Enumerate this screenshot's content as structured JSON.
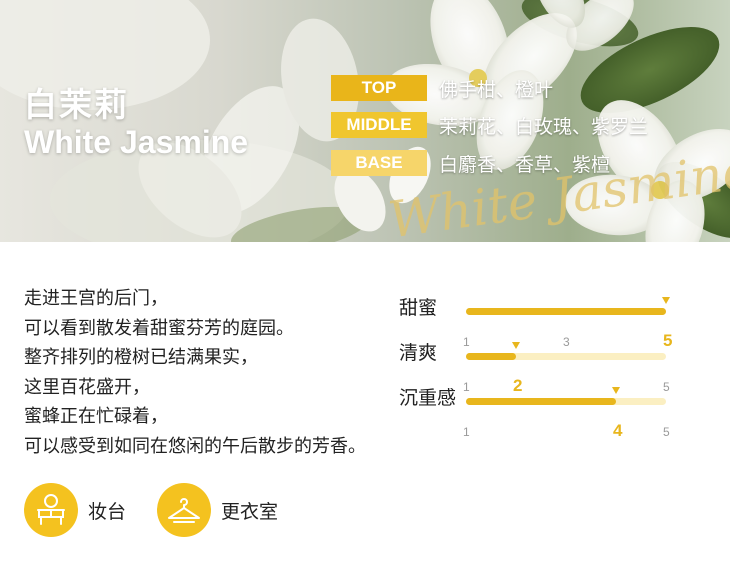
{
  "banner": {
    "title_cn": "白茉莉",
    "title_en": "White Jasmine",
    "script_text": "White Jasmine",
    "notes": [
      {
        "tag": "TOP",
        "value": "佛手柑、橙叶",
        "color": "#e9b51a"
      },
      {
        "tag": "MIDDLE",
        "value": "茉莉花、白玫瑰、紫罗兰",
        "color": "#f0c62e"
      },
      {
        "tag": "BASE",
        "value": "白麝香、香草、紫檀",
        "color": "#f6d56a"
      }
    ]
  },
  "description": {
    "lines": [
      "走进王宫的后门，",
      "可以看到散发着甜蜜芬芳的庭园。",
      "整齐排列的橙树已结满果实，",
      "这里百花盛开，",
      "蜜蜂正在忙碌着，",
      "可以感受到如同在悠闲的午后散步的芳香。"
    ]
  },
  "ratings": [
    {
      "label": "甜蜜",
      "value": 5,
      "max": 5,
      "ticks": [
        "1",
        "3",
        "5"
      ]
    },
    {
      "label": "清爽",
      "value": 2,
      "max": 5,
      "ticks": [
        "1",
        "2",
        "5"
      ]
    },
    {
      "label": "沉重感",
      "value": 4,
      "max": 5,
      "ticks": [
        "1",
        "4",
        "5"
      ]
    }
  ],
  "scenes": [
    {
      "label": "妆台",
      "icon": "dressing-table-icon"
    },
    {
      "label": "更衣室",
      "icon": "clothes-hanger-icon"
    }
  ],
  "colors": {
    "accent": "#e8b61d",
    "track": "#fbefc2",
    "icon_bg": "#f4c21f"
  }
}
